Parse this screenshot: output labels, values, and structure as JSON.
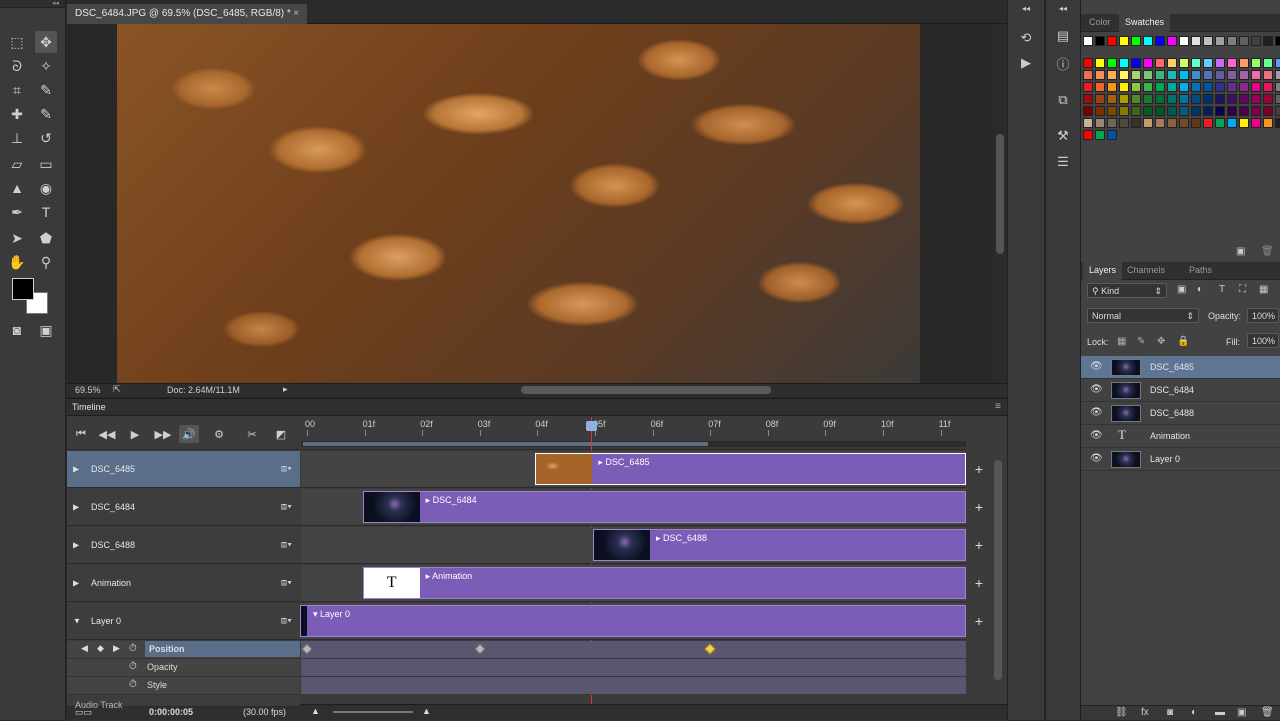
{
  "tools": {
    "names": [
      "marquee",
      "move",
      "lasso",
      "magic-wand",
      "crop",
      "eyedropper",
      "healing",
      "brush",
      "stamp",
      "history-brush",
      "eraser",
      "gradient",
      "blur",
      "dodge",
      "pen",
      "type",
      "path-select",
      "shape",
      "hand",
      "zoom",
      "foreground",
      "background",
      "quickmask",
      "screen-mode"
    ]
  },
  "document": {
    "tab_title": "DSC_6484.JPG @ 69.5% (DSC_6485, RGB/8) *",
    "close": "×"
  },
  "status": {
    "zoom": "69.5%",
    "doc_info": "Doc: 2.64M/11.1M"
  },
  "timeline": {
    "title": "Timeline",
    "ruler": [
      "00",
      "01f",
      "02f",
      "03f",
      "04f",
      "05f",
      "06f",
      "07f",
      "08f",
      "09f",
      "10f",
      "11f"
    ],
    "playhead_frame": 5,
    "tracks": [
      {
        "name": "DSC_6485",
        "expanded": false,
        "selected": true,
        "clip_label": "DSC_6485",
        "clip_start": 4,
        "thumb": "peanuts"
      },
      {
        "name": "DSC_6484",
        "expanded": false,
        "selected": false,
        "clip_label": "DSC_6484",
        "clip_start": 1,
        "thumb": "dark"
      },
      {
        "name": "DSC_6488",
        "expanded": false,
        "selected": false,
        "clip_label": "DSC_6488",
        "clip_start": 5,
        "thumb": "dark"
      },
      {
        "name": "Animation",
        "expanded": false,
        "selected": false,
        "clip_label": "Animation",
        "clip_start": 1,
        "thumb": "text"
      },
      {
        "name": "Layer 0",
        "expanded": true,
        "selected": false,
        "clip_label": "Layer 0",
        "clip_start": 0,
        "thumb": "dark"
      }
    ],
    "properties": [
      {
        "name": "Position",
        "highlighted": true,
        "keyframes": [
          0,
          3,
          7
        ],
        "yellow_keyframe": 7
      },
      {
        "name": "Opacity",
        "highlighted": false,
        "keyframes": []
      },
      {
        "name": "Style",
        "highlighted": false,
        "keyframes": []
      }
    ],
    "audio_track": "Audio Track",
    "timecode": "0:00:00:05",
    "fps": "(30.00 fps)",
    "thumb_text_glyph": "T",
    "add": "+"
  },
  "swatch_panel": {
    "tabs": [
      "Color",
      "Swatches"
    ],
    "active_tab": "Swatches",
    "row0": [
      "#ffffff",
      "#000000",
      "#ff0000",
      "#ffff00",
      "#00ff00",
      "#00ffff",
      "#0000ff",
      "#ff00ff",
      "#ffffff",
      "#e0e0e0",
      "#c0c0c0",
      "#a0a0a0",
      "#808080",
      "#606060",
      "#404040",
      "#202020",
      "#000000"
    ],
    "rows": [
      [
        "#ff0000",
        "#ffff00",
        "#00ff00",
        "#00ffff",
        "#0000ff",
        "#ff00ff",
        "#ff6666",
        "#ffcc66",
        "#ccff66",
        "#66ffcc",
        "#66ccff",
        "#cc66ff",
        "#ff66cc",
        "#ff9966",
        "#99ff66",
        "#66ff99",
        "#6699ff"
      ],
      [
        "#f26c4f",
        "#f68e55",
        "#fbaf5c",
        "#fff467",
        "#acd372",
        "#7cc576",
        "#3bb878",
        "#1abbb4",
        "#00bff3",
        "#438ccb",
        "#5574b9",
        "#605ca8",
        "#855fa8",
        "#a763a9",
        "#f06ea9",
        "#f26d7d",
        "#a0a0a0"
      ],
      [
        "#ed1c24",
        "#f26522",
        "#f7941d",
        "#fff200",
        "#8dc63f",
        "#39b54a",
        "#00a651",
        "#00a99d",
        "#00aeef",
        "#0072bc",
        "#0054a6",
        "#2e3192",
        "#662d91",
        "#92278f",
        "#ec008c",
        "#ed145b",
        "#808080"
      ],
      [
        "#9e0b0f",
        "#a0410d",
        "#a36209",
        "#aba000",
        "#598527",
        "#1a7b30",
        "#007236",
        "#00746b",
        "#0076a3",
        "#004b80",
        "#003471",
        "#1b1464",
        "#440e62",
        "#630460",
        "#9e005d",
        "#9e0039",
        "#606060"
      ],
      [
        "#790000",
        "#7b2e00",
        "#7d4900",
        "#827b00",
        "#406618",
        "#005e20",
        "#005826",
        "#005952",
        "#005b7f",
        "#003663",
        "#002157",
        "#0d004c",
        "#32004b",
        "#4b0049",
        "#7b0046",
        "#7a0026",
        "#404040"
      ],
      [
        "#c7b299",
        "#998675",
        "#736357",
        "#534741",
        "#37302d",
        "#c69c6d",
        "#a67c52",
        "#8c6239",
        "#754c24",
        "#603913",
        "#ed1c24",
        "#00a651",
        "#00aeef",
        "#fff200",
        "#ec008c",
        "#f7941d",
        "#202020"
      ],
      [
        "#ff0000",
        "#00a651",
        "#0054a6"
      ]
    ]
  },
  "layers_panel": {
    "tabs": [
      "Layers",
      "Channels",
      "Paths"
    ],
    "active_tab": "Layers",
    "filter": "Kind",
    "blend_mode": "Normal",
    "opacity_label": "Opacity:",
    "opacity": "100%",
    "lock_label": "Lock:",
    "fill_label": "Fill:",
    "fill": "100%",
    "layers": [
      {
        "name": "DSC_6485",
        "selected": true,
        "type": "image"
      },
      {
        "name": "DSC_6484",
        "selected": false,
        "type": "image"
      },
      {
        "name": "DSC_6488",
        "selected": false,
        "type": "image"
      },
      {
        "name": "Animation",
        "selected": false,
        "type": "text"
      },
      {
        "name": "Layer 0",
        "selected": false,
        "type": "image"
      }
    ]
  },
  "colors": {
    "clip": "#7b5cb6",
    "selection": "#5e7594",
    "playhead": "#dd3333"
  }
}
